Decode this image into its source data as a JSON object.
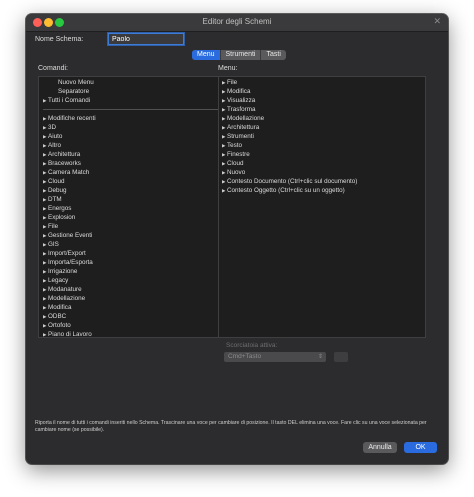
{
  "window": {
    "title": "Editor degli Schemi",
    "close_glyph": "✕"
  },
  "scheme": {
    "label": "Nome Schema:",
    "value": "Paolo"
  },
  "tabs": [
    {
      "label": "Menu",
      "active": true
    },
    {
      "label": "Strumenti",
      "active": false
    },
    {
      "label": "Tasti",
      "active": false
    }
  ],
  "commands": {
    "label": "Comandi:",
    "top_items": [
      {
        "label": "Nuovo Menu",
        "expandable": false
      },
      {
        "label": "Separatore",
        "expandable": false
      },
      {
        "label": "Tutti i Comandi",
        "expandable": true
      }
    ],
    "items": [
      "Modifiche recenti",
      "3D",
      "Aiuto",
      "Altro",
      "Architettura",
      "Braceworks",
      "Camera Match",
      "Cloud",
      "Debug",
      "DTM",
      "Energos",
      "Explosion",
      "File",
      "Gestione Eventi",
      "GIS",
      "Import/Export",
      "Importa/Esporta",
      "Irrigazione",
      "Legacy",
      "Modanature",
      "Modellazione",
      "Modifica",
      "ODBC",
      "Ortofoto",
      "Piano di Lavoro"
    ]
  },
  "menu": {
    "label": "Menu:",
    "items": [
      "File",
      "Modifica",
      "Visualizza",
      "Trasforma",
      "Modellazione",
      "Architettura",
      "Strumenti",
      "Testo",
      "Finestre",
      "Cloud",
      "Nuovo",
      "Contesto Documento (Ctrl+clic sul documento)",
      "Contesto Oggetto (Ctrl+clic su un oggetto)"
    ]
  },
  "shortcut": {
    "label": "Scorciatoia attiva:",
    "value": "Cmd+Tasto"
  },
  "help_text": "Riporta il nome di tutti i comandi inseriti nello Schema. Trascinare una voce per cambiare di posizione. Il tasto DEL elimina una voce. Fare clic su una voce selezionata per cambiare nome (se possibile).",
  "buttons": {
    "cancel": "Annulla",
    "ok": "OK"
  },
  "icons": {
    "expand": "disclosure-triangle-icon",
    "select": "chevron-updown-icon"
  },
  "colors": {
    "accent": "#2a6ce0",
    "window_bg": "#2c2c2e",
    "list_bg": "#1e1e1e"
  }
}
